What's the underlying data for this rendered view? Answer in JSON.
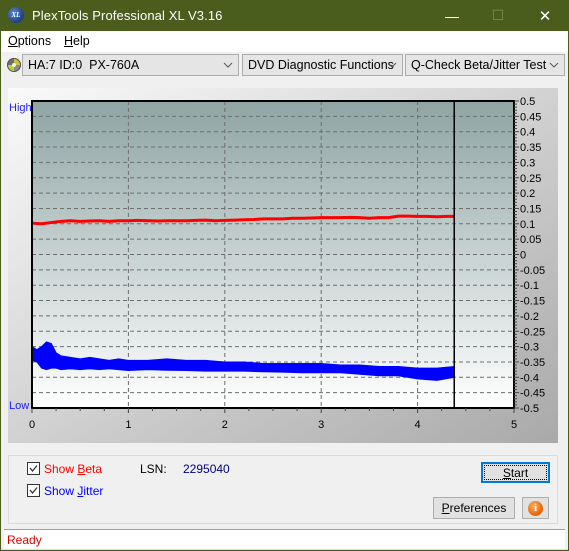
{
  "window": {
    "title": "PlexTools Professional XL V3.16",
    "app_icon_text": "XL",
    "minimize_glyph": "—",
    "maximize_glyph": "☐",
    "close_glyph": "✕"
  },
  "menu": [
    {
      "accel": "O",
      "rest": "ptions"
    },
    {
      "accel": "H",
      "rest": "elp"
    }
  ],
  "toolbar": {
    "drive_icon": "disc-icon",
    "drive": "HA:7 ID:0  PX-760A",
    "function": "DVD Diagnostic Functions",
    "test": "Q-Check Beta/Jitter Test"
  },
  "chart_labels": {
    "high": "High",
    "low": "Low"
  },
  "chart_data": {
    "type": "line",
    "title": "",
    "xlabel": "",
    "ylabel": "",
    "xlim": [
      0,
      5
    ],
    "ylim": [
      -0.5,
      0.5
    ],
    "x_ticks": [
      "0",
      "1",
      "2",
      "3",
      "4",
      "5"
    ],
    "x_minor_step": 0.25,
    "y_ticks": [
      "0.5",
      "0.45",
      "0.4",
      "0.35",
      "0.3",
      "0.25",
      "0.2",
      "0.15",
      "0.1",
      "0.05",
      "0",
      "-0.05",
      "-0.1",
      "-0.15",
      "-0.2",
      "-0.25",
      "-0.3",
      "-0.35",
      "-0.4",
      "-0.45",
      "-0.5"
    ],
    "y_minor_step": 0.01,
    "grid": true,
    "cursor_x": 4.38,
    "colors": {
      "beta": "#ff0000",
      "jitter": "#0000ff",
      "plot_top": "#8fa4a4",
      "plot_bottom": "#ffffff"
    },
    "series": [
      {
        "name": "Beta",
        "x": [
          0,
          0.1,
          0.2,
          0.3,
          0.4,
          0.5,
          0.6,
          0.7,
          0.8,
          0.9,
          1.0,
          1.1,
          1.2,
          1.3,
          1.4,
          1.5,
          1.6,
          1.7,
          1.8,
          1.9,
          2.0,
          2.1,
          2.2,
          2.3,
          2.4,
          2.5,
          2.6,
          2.7,
          2.8,
          2.9,
          3.0,
          3.1,
          3.2,
          3.3,
          3.4,
          3.5,
          3.6,
          3.7,
          3.8,
          3.9,
          4.0,
          4.1,
          4.2,
          4.3,
          4.38
        ],
        "y": [
          0.102,
          0.1,
          0.104,
          0.108,
          0.11,
          0.108,
          0.109,
          0.11,
          0.108,
          0.11,
          0.11,
          0.111,
          0.11,
          0.109,
          0.11,
          0.11,
          0.11,
          0.111,
          0.112,
          0.11,
          0.111,
          0.112,
          0.113,
          0.114,
          0.116,
          0.116,
          0.116,
          0.118,
          0.118,
          0.119,
          0.12,
          0.12,
          0.12,
          0.121,
          0.12,
          0.118,
          0.12,
          0.12,
          0.125,
          0.125,
          0.124,
          0.124,
          0.123,
          0.124,
          0.124
        ]
      },
      {
        "name": "Jitter",
        "x": [
          0,
          0.05,
          0.1,
          0.15,
          0.2,
          0.25,
          0.3,
          0.4,
          0.5,
          0.6,
          0.7,
          0.8,
          0.9,
          1.0,
          1.2,
          1.4,
          1.6,
          1.8,
          2.0,
          2.2,
          2.4,
          2.6,
          2.8,
          3.0,
          3.2,
          3.4,
          3.6,
          3.8,
          4.0,
          4.2,
          4.38
        ],
        "upper": [
          -0.3,
          -0.31,
          -0.3,
          -0.285,
          -0.29,
          -0.32,
          -0.33,
          -0.335,
          -0.34,
          -0.335,
          -0.34,
          -0.345,
          -0.34,
          -0.345,
          -0.345,
          -0.34,
          -0.345,
          -0.345,
          -0.35,
          -0.35,
          -0.355,
          -0.355,
          -0.355,
          -0.355,
          -0.36,
          -0.36,
          -0.365,
          -0.365,
          -0.37,
          -0.37,
          -0.365
        ],
        "lower": [
          -0.345,
          -0.35,
          -0.37,
          -0.375,
          -0.37,
          -0.37,
          -0.375,
          -0.372,
          -0.375,
          -0.372,
          -0.375,
          -0.372,
          -0.375,
          -0.378,
          -0.375,
          -0.377,
          -0.378,
          -0.38,
          -0.38,
          -0.38,
          -0.382,
          -0.383,
          -0.385,
          -0.385,
          -0.385,
          -0.39,
          -0.395,
          -0.395,
          -0.405,
          -0.41,
          -0.4
        ]
      }
    ]
  },
  "options": {
    "show_beta": {
      "pre": "Show ",
      "accel": "B",
      "post": "eta",
      "checked": true,
      "color": "#ff0000"
    },
    "show_jitter": {
      "pre": "Show ",
      "accel": "J",
      "post": "itter",
      "checked": true,
      "color": "#0000ff"
    }
  },
  "lsn": {
    "label": "LSN:",
    "value": "2295040"
  },
  "buttons": {
    "start": {
      "accel": "S",
      "rest": "tart"
    },
    "preferences": {
      "accel": "P",
      "rest": "references"
    },
    "info_glyph": "i"
  },
  "status": {
    "text": "Ready"
  }
}
